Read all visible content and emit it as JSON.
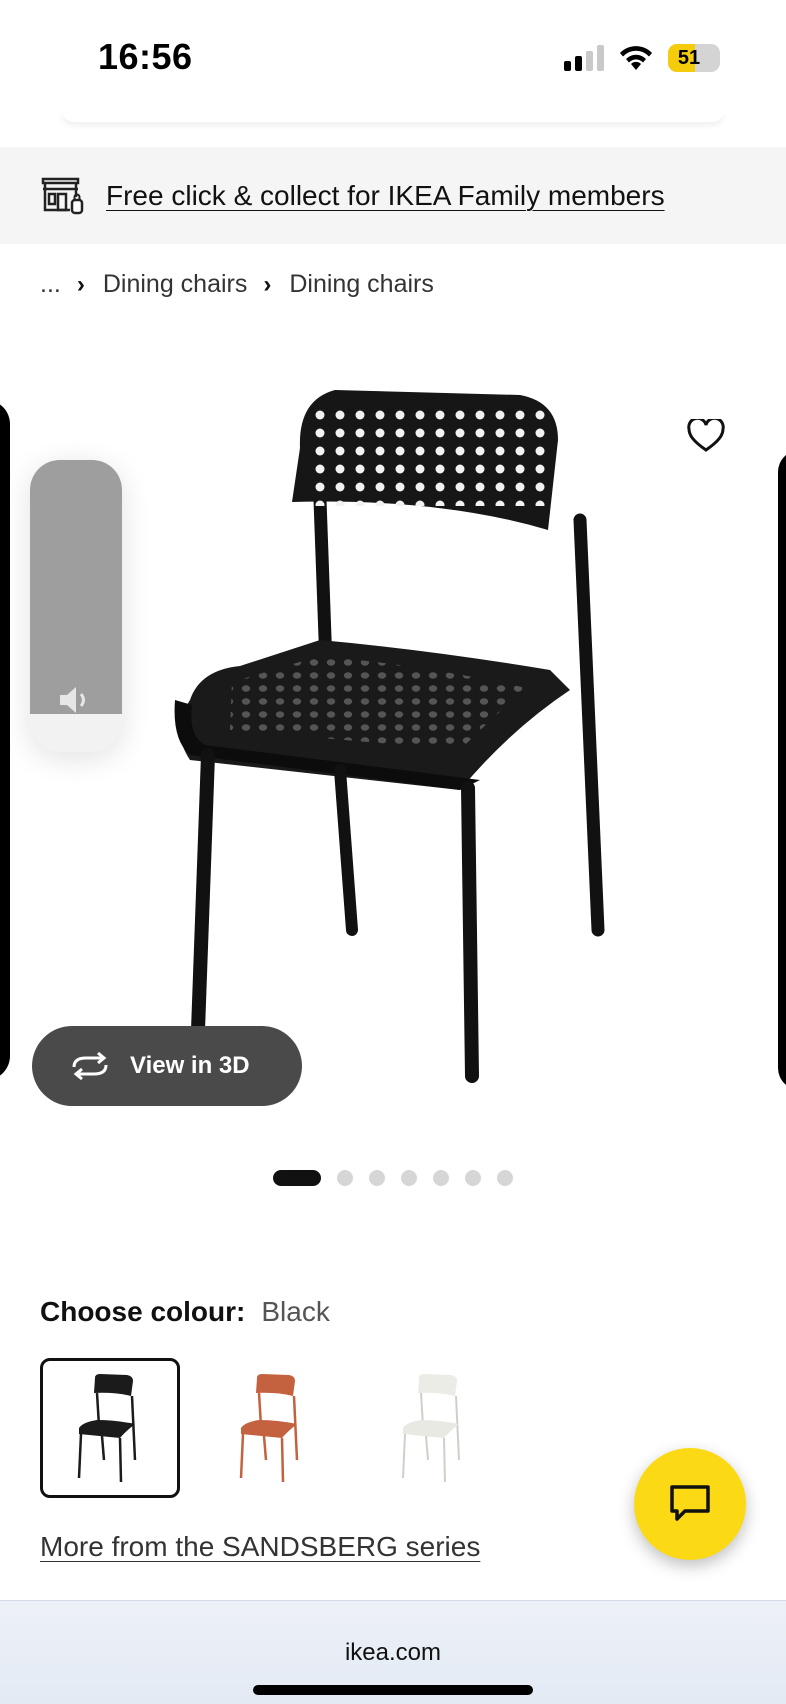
{
  "status_bar": {
    "time": "16:56",
    "battery_level": "51",
    "battery_color": "#f4cc0c"
  },
  "promo": {
    "icon": "store-icon",
    "text": "Free click & collect for IKEA Family members"
  },
  "breadcrumb": {
    "ellipsis": "...",
    "items": [
      "Dining chairs",
      "Dining chairs"
    ]
  },
  "gallery": {
    "view_3d_label": "View in 3D",
    "image_count": 7,
    "active_index": 0,
    "volume_level": 0.87
  },
  "colour": {
    "label": "Choose colour:",
    "value": "Black",
    "options": [
      {
        "name": "black",
        "color": "#1b1b1b",
        "selected": true
      },
      {
        "name": "orange",
        "color": "#c4613e",
        "selected": false
      },
      {
        "name": "white",
        "color": "#e9e9e4",
        "selected": false
      }
    ]
  },
  "series_link": "More from the SANDSBERG series",
  "browser": {
    "url": "ikea.com"
  },
  "colors": {
    "brand_yellow": "#fbd914",
    "banner_bg": "#f5f5f5"
  }
}
